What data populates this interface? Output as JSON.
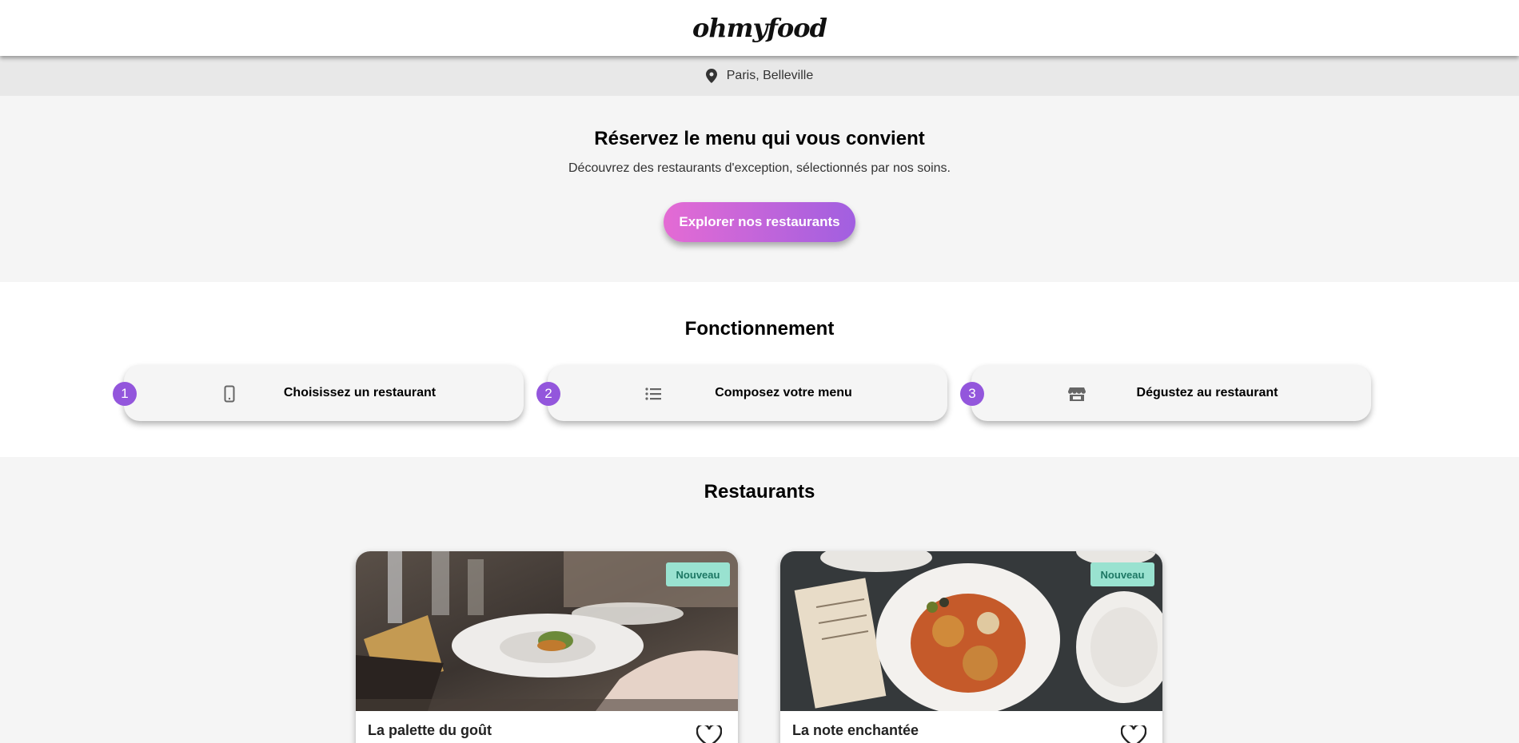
{
  "header": {
    "logo": "ohmyfood"
  },
  "location": {
    "icon": "map-pin-icon",
    "text": "Paris, Belleville"
  },
  "hero": {
    "title": "Réservez le menu qui vous convient",
    "subtitle": "Découvrez des restaurants d'exception, sélectionnés par nos soins.",
    "cta_label": "Explorer nos restaurants"
  },
  "how": {
    "title": "Fonctionnement",
    "steps": [
      {
        "number": "1",
        "icon": "mobile-phone-icon",
        "label": "Choisissez un restaurant"
      },
      {
        "number": "2",
        "icon": "list-icon",
        "label": "Composez votre menu"
      },
      {
        "number": "3",
        "icon": "storefront-icon",
        "label": "Dégustez au restaurant"
      }
    ]
  },
  "restaurants": {
    "title": "Restaurants",
    "items": [
      {
        "name": "La palette du goût",
        "badge": "Nouveau",
        "icon": "heart-icon"
      },
      {
        "name": "La note enchantée",
        "badge": "Nouveau",
        "icon": "heart-icon"
      }
    ]
  },
  "colors": {
    "accent_purple": "#9356dc",
    "cta_gradient_start": "#e46bd4",
    "cta_gradient_end": "#a15fe0",
    "badge_bg": "#99e2d0",
    "badge_text": "#1d7764"
  }
}
